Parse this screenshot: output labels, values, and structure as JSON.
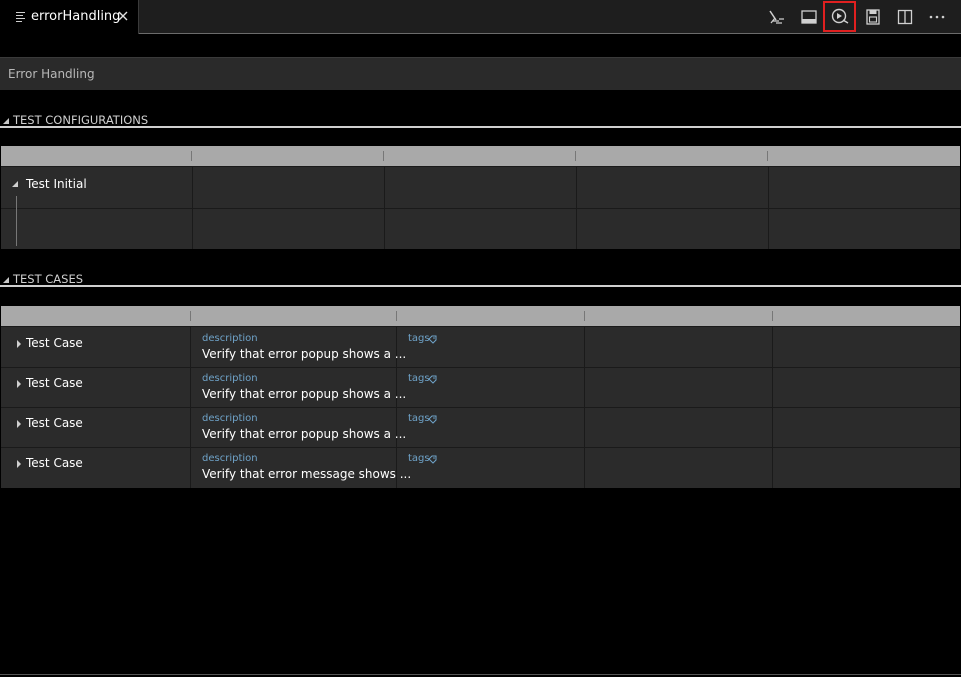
{
  "tab": {
    "label": "errorHandling"
  },
  "document": {
    "title": "Error Handling"
  },
  "sections": {
    "configurations": {
      "label": "TEST CONFIGURATIONS"
    },
    "cases": {
      "label": "TEST CASES"
    }
  },
  "configurations": {
    "rows": [
      {
        "label": "Test Initial"
      }
    ]
  },
  "cases": {
    "rows": [
      {
        "label": "Test Case",
        "description_key": "description",
        "description": "Verify that error popup shows a ...",
        "tags_key": "tags"
      },
      {
        "label": "Test Case",
        "description_key": "description",
        "description": "Verify that error popup shows a ...",
        "tags_key": "tags"
      },
      {
        "label": "Test Case",
        "description_key": "description",
        "description": "Verify that error popup shows a ...",
        "tags_key": "tags"
      },
      {
        "label": "Test Case",
        "description_key": "description",
        "description": "Verify that error message shows ...",
        "tags_key": "tags"
      }
    ]
  },
  "toolbar": {
    "icons": [
      "cleanup-icon",
      "panel-icon",
      "run-test-icon",
      "save-icon",
      "split-editor-icon",
      "more-actions-icon"
    ],
    "highlighted": "run-test-icon"
  },
  "colors": {
    "background": "#000000",
    "grid": "#2b2b2b",
    "grid_header": "#a9a9a9",
    "field_key": "#6fa3c9",
    "highlight": "#e02020"
  }
}
